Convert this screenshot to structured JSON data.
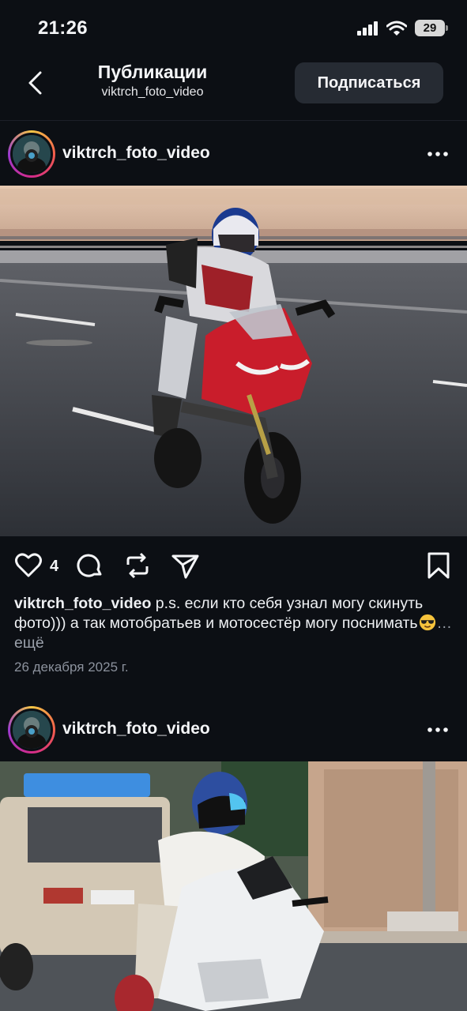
{
  "status_bar": {
    "time": "21:26",
    "battery_level": "29",
    "icons": [
      "signal-icon",
      "wifi-icon",
      "battery-icon"
    ]
  },
  "nav": {
    "title": "Публикации",
    "subtitle": "viktrch_foto_video",
    "subscribe_label": "Подписаться",
    "back_icon": "chevron-left-icon"
  },
  "posts": [
    {
      "username": "viktrch_foto_video",
      "image": "motorcycle-photo",
      "likes": "4",
      "caption_user": "viktrch_foto_video",
      "caption_text": " p.s. если кто себя узнал могу скинуть фото))) а так мотобратьев и мотосестёр могу поснимать",
      "caption_emoji": "sunglasses-emoji",
      "caption_more": "… ещё",
      "date": "26 декабря 2025 г."
    },
    {
      "username": "viktrch_foto_video",
      "image": "motorcycle-photo"
    }
  ],
  "actions": [
    "heart-icon",
    "comment-icon",
    "repost-icon",
    "share-icon",
    "bookmark-icon"
  ],
  "colors": {
    "background": "#0c0f14",
    "button": "#262b33",
    "muted_text": "#8c929d",
    "bike_red": "#c91d2b"
  }
}
